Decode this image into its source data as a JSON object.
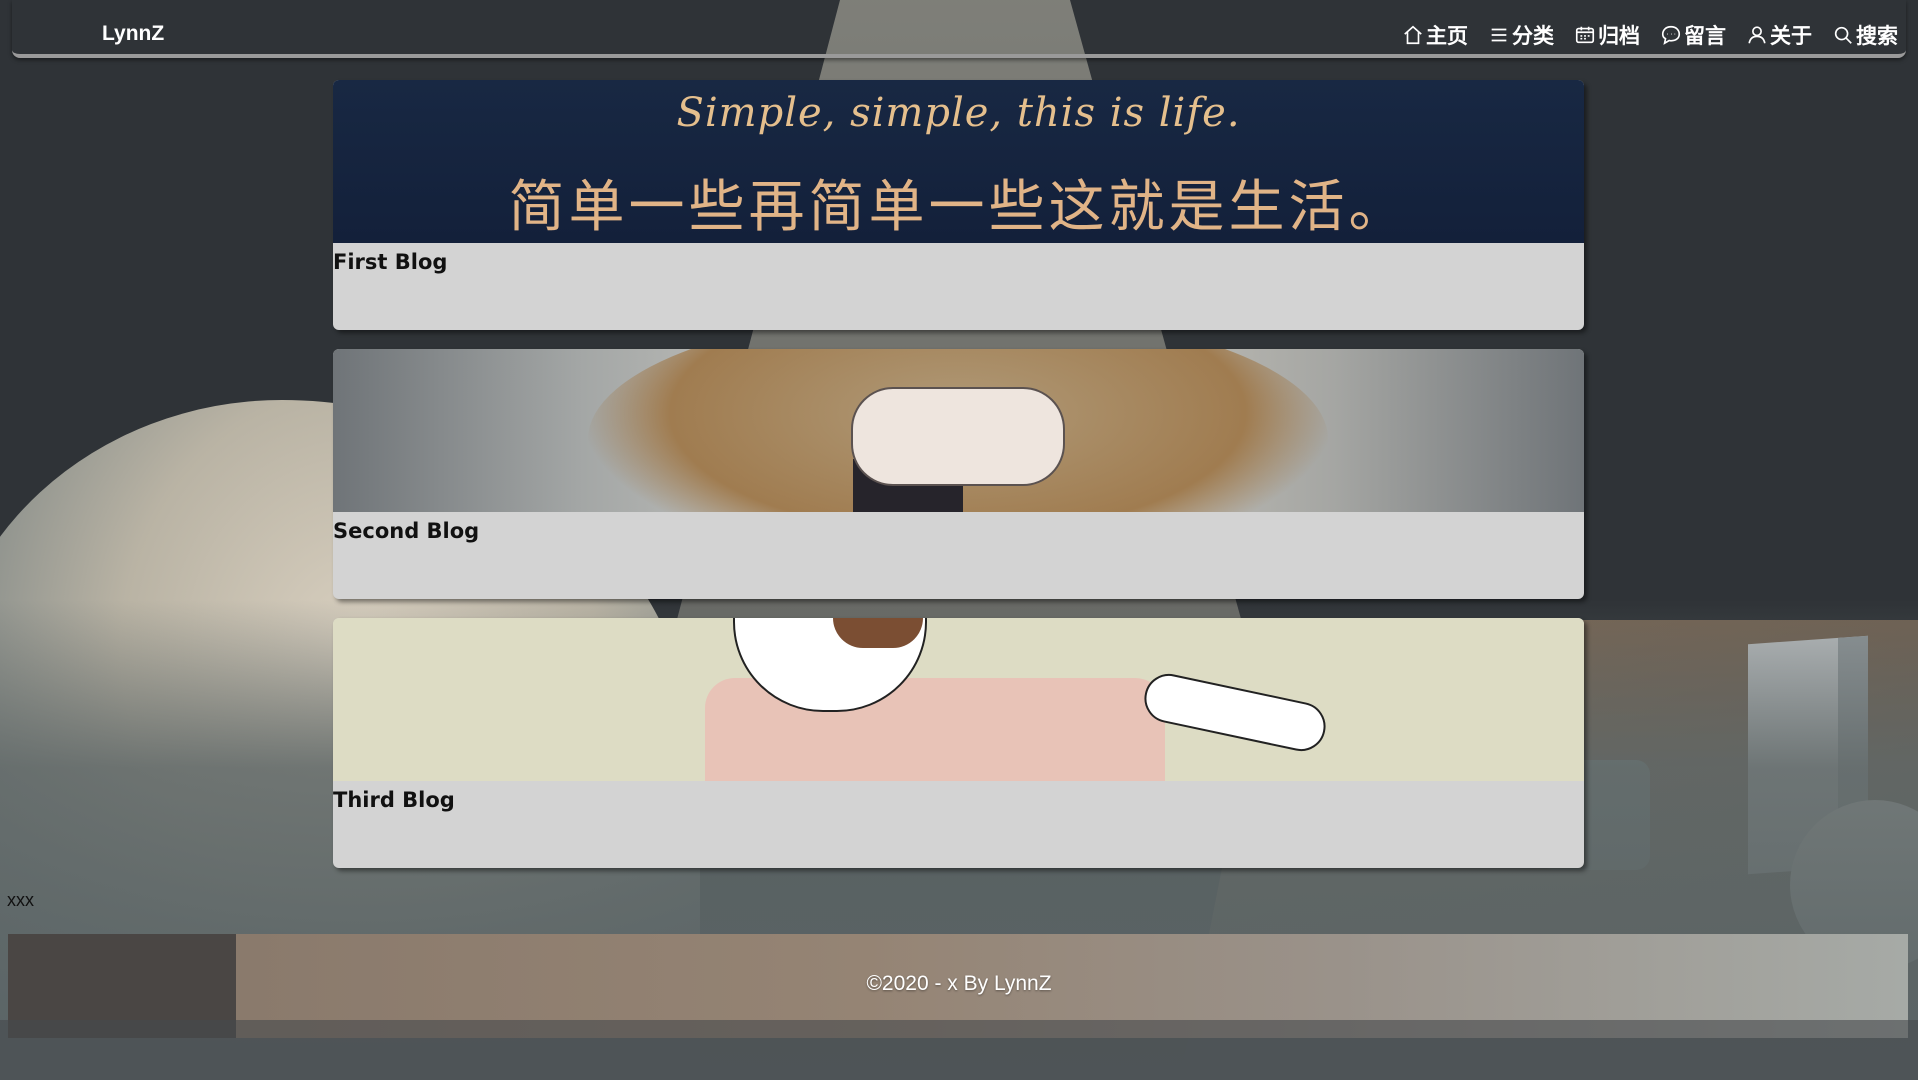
{
  "header": {
    "brand": "LynnZ",
    "nav": [
      {
        "icon": "home-icon",
        "label": "主页"
      },
      {
        "icon": "list-icon",
        "label": "分类"
      },
      {
        "icon": "calendar-icon",
        "label": "归档"
      },
      {
        "icon": "comment-icon",
        "label": "留言"
      },
      {
        "icon": "user-icon",
        "label": "关于"
      },
      {
        "icon": "search-icon",
        "label": "搜索"
      }
    ]
  },
  "posts": [
    {
      "title": "First Blog",
      "cover": {
        "caption_en": "Simple, simple, this is life.",
        "caption_zh": "简单一些再简单一些这就是生活。"
      }
    },
    {
      "title": "Second Blog"
    },
    {
      "title": "Third Blog"
    }
  ],
  "page": {
    "stray_text": "xxx"
  },
  "footer": {
    "copyright": "©2020 - x By LynnZ"
  }
}
